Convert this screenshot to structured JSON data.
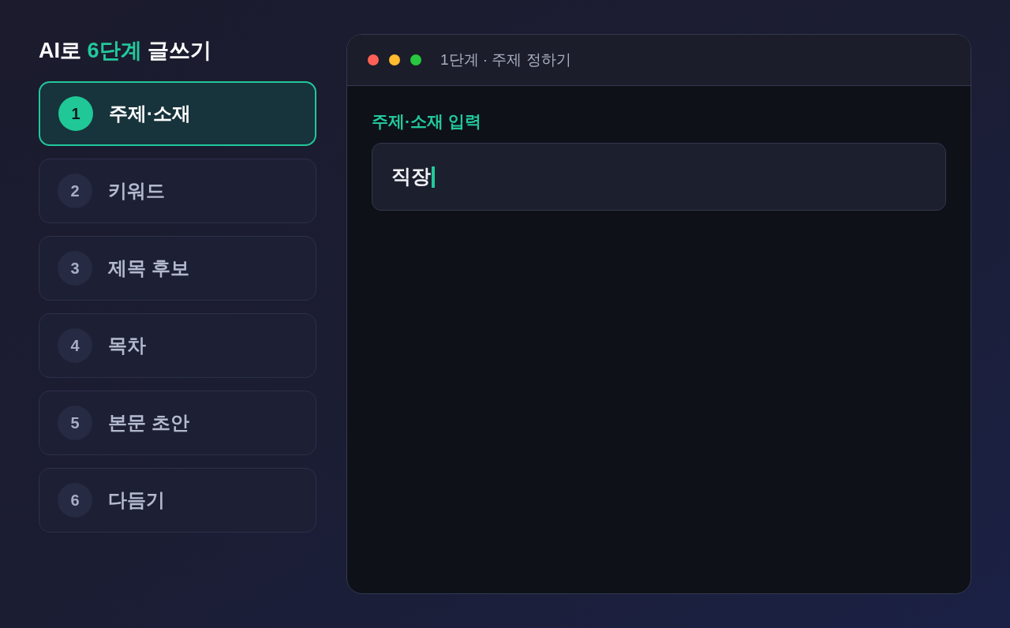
{
  "heading": {
    "parts": [
      {
        "text": "AI로 ",
        "accent": false
      },
      {
        "text": "6단계",
        "accent": true
      },
      {
        "text": " 글쓰기",
        "accent": false
      }
    ]
  },
  "steps": [
    {
      "number": "1",
      "label": "주제·소재",
      "selected": true
    },
    {
      "number": "2",
      "label": "키워드",
      "selected": false
    },
    {
      "number": "3",
      "label": "제목 후보",
      "selected": false
    },
    {
      "number": "4",
      "label": "목차",
      "selected": false
    },
    {
      "number": "5",
      "label": "본문 초안",
      "selected": false
    },
    {
      "number": "6",
      "label": "다듬기",
      "selected": false
    }
  ],
  "window": {
    "title": "1단계 · 주제 정하기"
  },
  "topic_field": {
    "label": "주제·소재 입력",
    "value": "직장",
    "focused": true
  }
}
